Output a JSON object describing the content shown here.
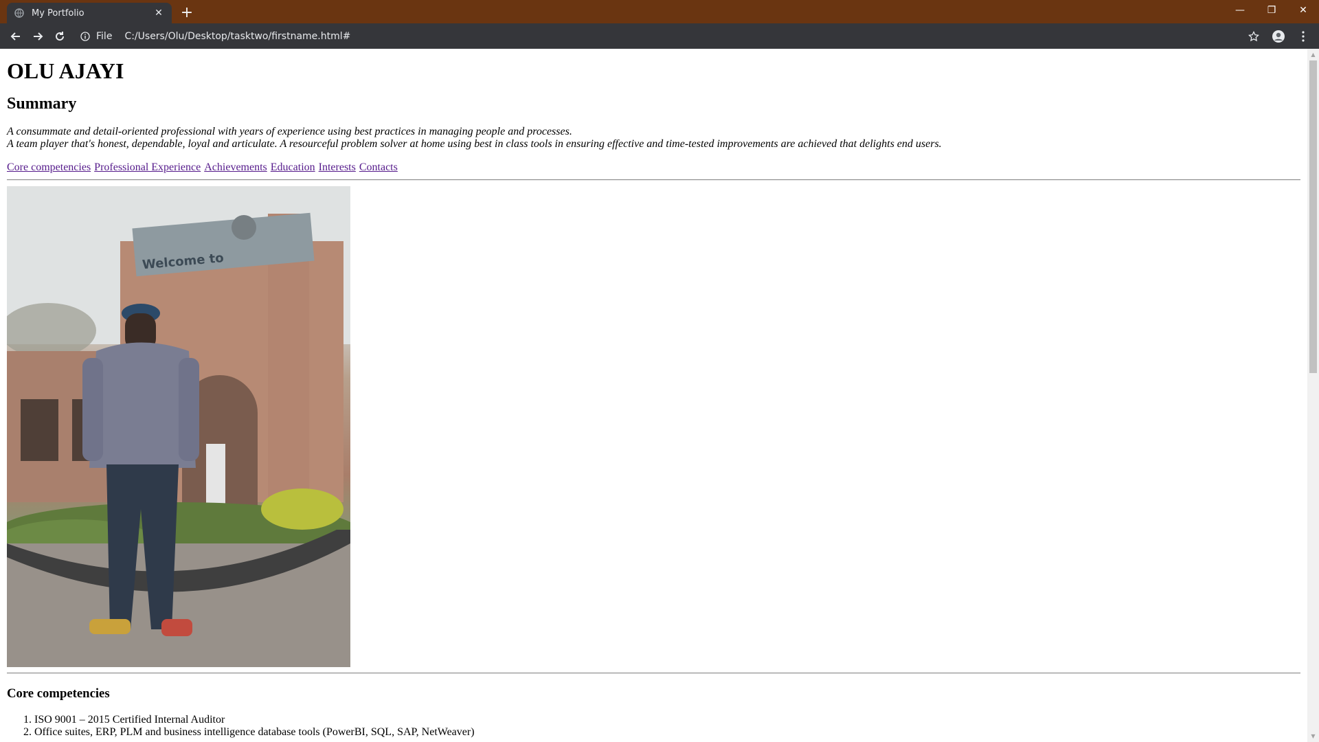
{
  "browser": {
    "tab_title": "My Portfolio",
    "scheme_label": "File",
    "url": "C:/Users/Olu/Desktop/tasktwo/firstname.html#",
    "icons": [
      "globe-icon",
      "close-icon",
      "plus-icon",
      "back-icon",
      "forward-icon",
      "reload-icon",
      "info-icon",
      "star-icon",
      "profile-icon",
      "menu-icon"
    ]
  },
  "page": {
    "name": "OLU AJAYI",
    "summary_heading": "Summary",
    "summary_line1": "A consummate and detail-oriented professional with years of experience using best practices in managing people and processes.",
    "summary_line2": "A team player that's honest, dependable, loyal and articulate. A resourceful problem solver at home using best in class tools in ensuring effective and time-tested improvements are achieved that delights end users.",
    "nav": [
      "Core competencies",
      "Professional Experience",
      "Achievements",
      "Education",
      "Interests",
      "Contacts"
    ],
    "photo_sign_text": "Welcome to",
    "core_heading": "Core competencies",
    "core_items": [
      "ISO 9001 – 2015 Certified Internal Auditor",
      "Office suites, ERP, PLM and business intelligence database tools (PowerBI, SQL, SAP, NetWeaver)"
    ]
  },
  "colors": {
    "tabstrip": "#6a3511",
    "toolbar": "#35363a",
    "visited_link": "#551a8b"
  }
}
